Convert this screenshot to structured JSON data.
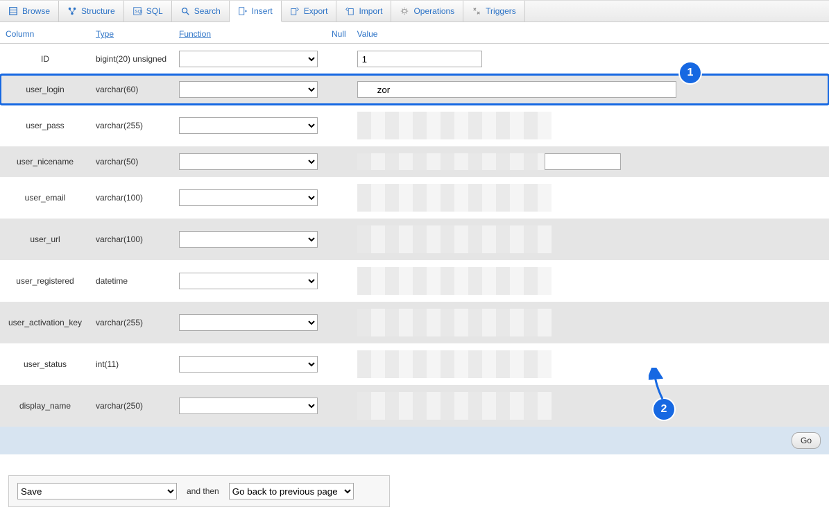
{
  "tabs": [
    {
      "label": "Browse",
      "icon": "browse"
    },
    {
      "label": "Structure",
      "icon": "structure"
    },
    {
      "label": "SQL",
      "icon": "sql"
    },
    {
      "label": "Search",
      "icon": "search"
    },
    {
      "label": "Insert",
      "icon": "insert",
      "active": true
    },
    {
      "label": "Export",
      "icon": "export"
    },
    {
      "label": "Import",
      "icon": "import"
    },
    {
      "label": "Operations",
      "icon": "operations"
    },
    {
      "label": "Triggers",
      "icon": "triggers"
    }
  ],
  "headers": {
    "column": "Column",
    "type": "Type",
    "function": "Function",
    "null": "Null",
    "value": "Value"
  },
  "rows": [
    {
      "column": "ID",
      "type": "bigint(20) unsigned",
      "value": "1",
      "highlight": false,
      "valueStyle": "short"
    },
    {
      "column": "user_login",
      "type": "varchar(60)",
      "value": "zor",
      "highlight": true,
      "valueStyle": "xlong"
    },
    {
      "column": "user_pass",
      "type": "varchar(255)",
      "value": "",
      "redacted": true
    },
    {
      "column": "user_nicename",
      "type": "varchar(50)",
      "value": "",
      "valueStyle": "long",
      "halfRedacted": true
    },
    {
      "column": "user_email",
      "type": "varchar(100)",
      "value": "",
      "redacted": true
    },
    {
      "column": "user_url",
      "type": "varchar(100)",
      "value": "",
      "redacted": true
    },
    {
      "column": "user_registered",
      "type": "datetime",
      "value": "",
      "redacted": true
    },
    {
      "column": "user_activation_key",
      "type": "varchar(255)",
      "value": "",
      "redacted": true
    },
    {
      "column": "user_status",
      "type": "int(11)",
      "value": "",
      "redacted": true
    },
    {
      "column": "display_name",
      "type": "varchar(250)",
      "value": "",
      "redacted": true
    }
  ],
  "goButton": "Go",
  "bottom": {
    "saveSelect": "Save",
    "andThen": "and then",
    "afterSelect": "Go back to previous page"
  },
  "annotations": {
    "badge1": "1",
    "badge2": "2"
  }
}
